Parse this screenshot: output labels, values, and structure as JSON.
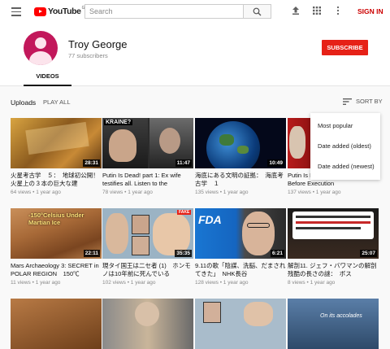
{
  "header": {
    "logo_text": "YouTube",
    "logo_sup": "GB",
    "search_placeholder": "Search",
    "signin_label": "SIGN IN"
  },
  "channel": {
    "name": "Troy George",
    "subscribers": "77 subscribers",
    "subscribe_label": "SUBSCRIBE",
    "tab_videos": "VIDEOS",
    "avatar_color": "#c2185b"
  },
  "toolbar": {
    "uploads_label": "Uploads",
    "play_all_label": "PLAY ALL",
    "sort_label": "SORT BY"
  },
  "sort_menu": {
    "options": [
      "Most popular",
      "Date added (oldest)",
      "Date added (newest)"
    ]
  },
  "videos": [
    {
      "title": "火星考古学　５：　地球初公開！火星上の３本の巨大な建",
      "views": "64 views",
      "age": "1 year ago",
      "duration": "28:31"
    },
    {
      "title": "Putin Is Dead! part 1: Ex wife testifies all. Listen to the",
      "views": "78 views",
      "age": "1 year ago",
      "duration": "11:47"
    },
    {
      "title": "海底にある文明の証拠：　海底考古学　１",
      "views": "135 views",
      "age": "1 year ago",
      "duration": "10:49"
    },
    {
      "title": "Putin Is Dead! part 2: See Putin Before Execution",
      "views": "137 views",
      "age": "1 year ago",
      "duration": ""
    },
    {
      "title": "Mars Archaeology 3: SECRET in POLAR REGION　150℃",
      "views": "11 views",
      "age": "1 year ago",
      "duration": "22:11"
    },
    {
      "title": "現タイ国王は二セ者 (1)　ホンモノは10年前に死んでいる",
      "views": "102 views",
      "age": "1 year ago",
      "duration": "35:35"
    },
    {
      "title": "9.11の歌「陰謀、洗脳、だまされてきた」　NHK長谷",
      "views": "128 views",
      "age": "1 year ago",
      "duration": "6:21"
    },
    {
      "title": "解剖11. ジェフ・バワマンの解剖 残酷の長さの謎：　ボス",
      "views": "8 views",
      "age": "1 year ago",
      "duration": "25:07"
    }
  ],
  "thumb_overlays": {
    "krain": "KRAINE?",
    "fda": "FDA",
    "mars_text": "-150°Celsius Under Martian Ice",
    "row3_text": "On its accolades"
  }
}
